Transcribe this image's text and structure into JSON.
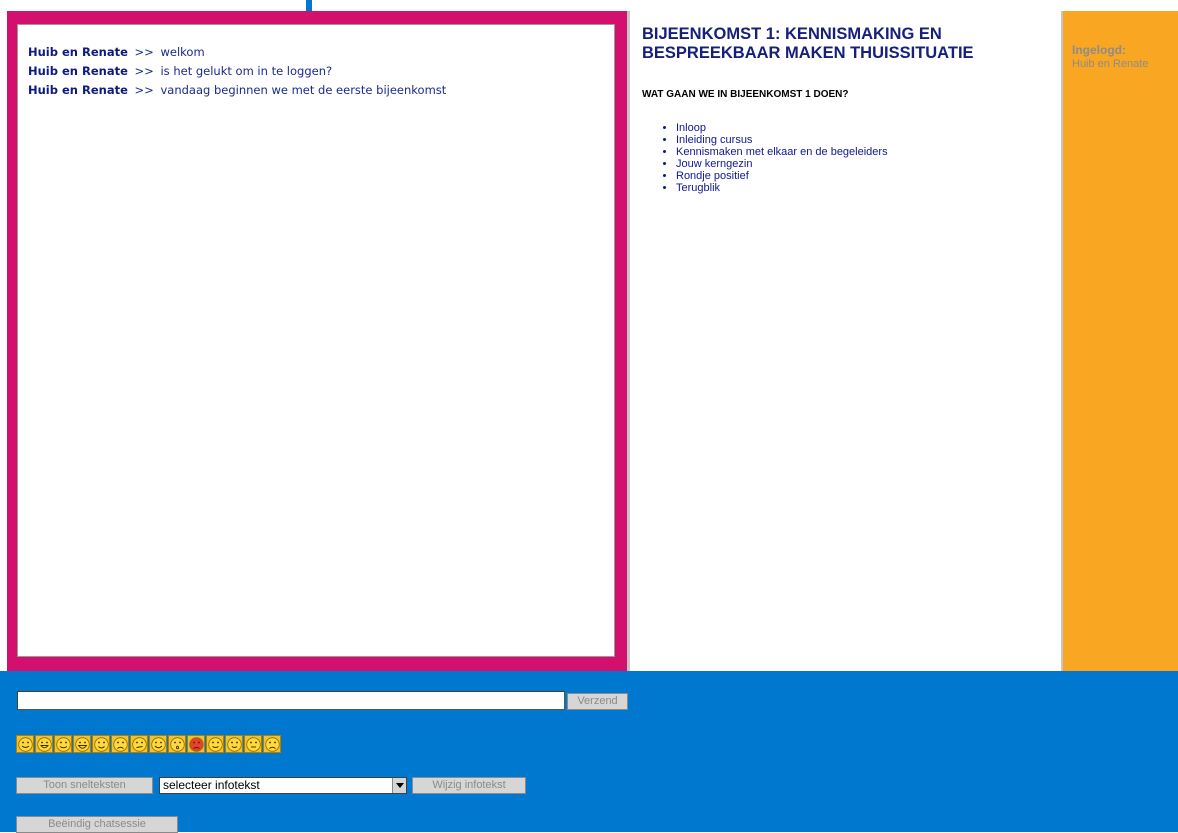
{
  "chat": {
    "messages": [
      {
        "sender": "Huib en Renate",
        "separator": ">>",
        "text": "welkom"
      },
      {
        "sender": "Huib en Renate",
        "separator": ">>",
        "text": "is het gelukt om in te loggen?"
      },
      {
        "sender": "Huib en Renate",
        "separator": ">>",
        "text": "vandaag beginnen we met de eerste bijeenkomst"
      }
    ]
  },
  "content": {
    "title": "BIJEENKOMST 1: KENNISMAKING EN\nBESPREEKBAAR MAKEN THUISSITUATIE",
    "subtitle": "WAT GAAN WE IN BIJEENKOMST 1 DOEN?",
    "items": [
      "Inloop",
      "Inleiding cursus",
      "Kennismaken met elkaar en de begeleiders",
      "Jouw kerngezin",
      "Rondje positief",
      "Terugblik"
    ]
  },
  "login": {
    "label": "Ingelogd:",
    "user": "Huib en Renate"
  },
  "controls": {
    "message_value": "",
    "send_label": "Verzend",
    "emoticons": [
      "smile-icon",
      "grin-icon",
      "wink-icon",
      "laugh-icon",
      "tongue-icon",
      "sad-icon",
      "confused-icon",
      "happy-icon",
      "surprised-icon",
      "angry-icon",
      "cool-icon",
      "blush-icon",
      "neutral-icon",
      "cry-icon"
    ],
    "quick_texts_label": "Toon snelteksten",
    "info_select_value": "selecteer infotekst",
    "edit_info_label": "Wijzig infotekst",
    "end_session_label": "Beëindig chatsessie"
  },
  "colors": {
    "chat_frame": "#d4106e",
    "login_panel": "#f9a623",
    "bottom_bar": "#0078d0",
    "text_navy": "#16207a"
  }
}
